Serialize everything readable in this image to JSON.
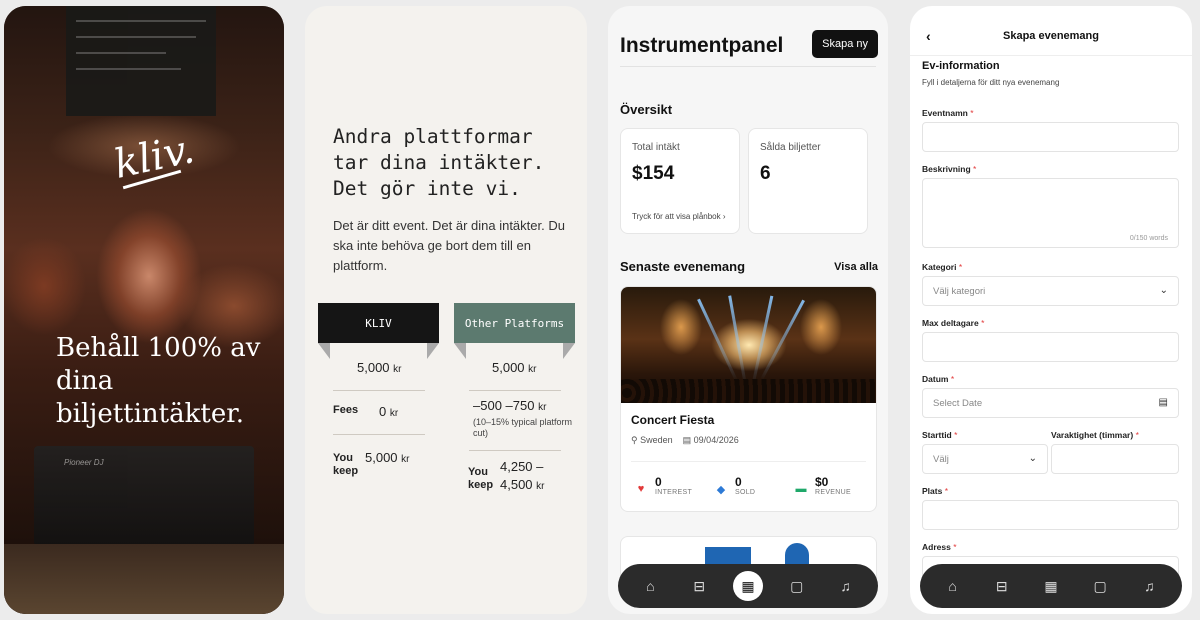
{
  "screen1": {
    "logo": "kliv.",
    "headline": "Behåll 100% av dina biljettintäkter.",
    "deck_brand": "Pioneer DJ"
  },
  "screen2": {
    "heading": "Andra plattformar tar dina intäkter. Det gör inte vi.",
    "body": "Det är ditt event. Det är dina intäkter. Du ska inte behöva ge bort dem till en plattform.",
    "col_kliv": "KLIV",
    "col_other": "Other Platforms",
    "kliv_price": "5,000",
    "kliv_price_unit": "kr",
    "other_price": "5,000",
    "other_price_unit": "kr",
    "fees_label": "Fees",
    "kliv_fees": "0",
    "kliv_fees_unit": "kr",
    "other_fees": "–500 –750",
    "other_fees_unit": "kr",
    "other_fees_note": "(10–15% typical platform cut)",
    "keep_label_1": "You",
    "keep_label_2": "keep",
    "kliv_keep": "5,000",
    "kliv_keep_unit": "kr",
    "other_keep_1": "4,250 –",
    "other_keep_2": "4,500",
    "other_keep_unit": "kr"
  },
  "screen3": {
    "title": "Instrumentpanel",
    "create_button": "Skapa ny",
    "overview": "Översikt",
    "total_income_label": "Total intäkt",
    "total_income_value": "$154",
    "wallet_link": "Tryck för att visa plånbok",
    "tickets_sold_label": "Sålda biljetter",
    "tickets_sold_value": "6",
    "recent_events": "Senaste evenemang",
    "view_all": "Visa alla",
    "event_name": "Concert Fiesta",
    "event_location": "Sweden",
    "event_date": "09/04/2026",
    "interest_value": "0",
    "interest_label": "INTEREST",
    "sold_value": "0",
    "sold_label": "SOLD",
    "revenue_value": "$0",
    "revenue_label": "REVENUE"
  },
  "screen4": {
    "back": "‹",
    "title": "Skapa evenemang",
    "section": "Ev-information",
    "subtitle": "Fyll i detaljerna för ditt nya evenemang",
    "event_name_label": "Eventnamn",
    "description_label": "Beskrivning",
    "description_counter": "0/150 words",
    "category_label": "Kategori",
    "category_placeholder": "Välj kategori",
    "max_participants_label": "Max deltagare",
    "date_label": "Datum",
    "date_placeholder": "Select Date",
    "start_time_label": "Starttid",
    "start_time_placeholder": "Välj",
    "duration_label": "Varaktighet (timmar)",
    "place_label": "Plats",
    "address_label": "Adress",
    "required_mark": "*"
  },
  "colors": {
    "brand_dark": "#111111",
    "other_platforms_green": "#5c7a6f",
    "required_red": "#e23a3a",
    "nav_bar": "#2b2b2b"
  }
}
